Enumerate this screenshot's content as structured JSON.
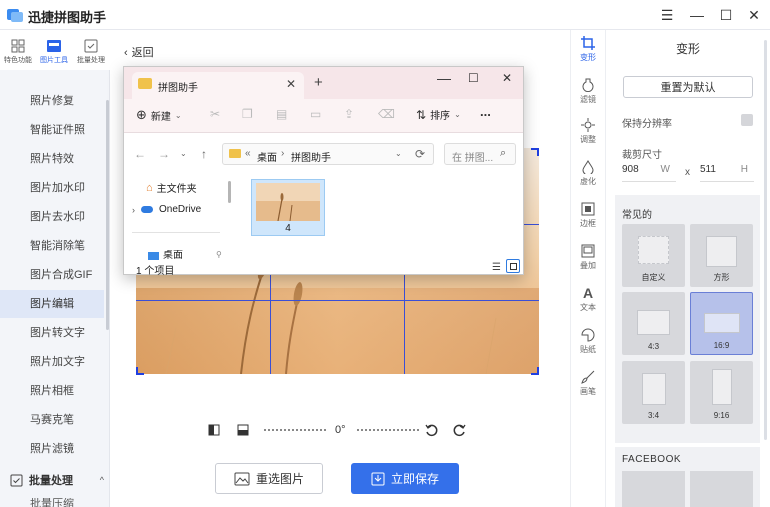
{
  "app": {
    "title": "迅捷拼图助手"
  },
  "topnav": [
    {
      "label": "特色功能"
    },
    {
      "label": "图片工具"
    },
    {
      "label": "批量处理"
    }
  ],
  "sidebar": {
    "items": [
      {
        "label": "照片修复"
      },
      {
        "label": "智能证件照"
      },
      {
        "label": "照片特效"
      },
      {
        "label": "图片加水印"
      },
      {
        "label": "图片去水印"
      },
      {
        "label": "智能消除笔"
      },
      {
        "label": "图片合成GIF"
      },
      {
        "label": "图片编辑"
      },
      {
        "label": "图片转文字"
      },
      {
        "label": "照片加文字"
      },
      {
        "label": "照片相框"
      },
      {
        "label": "马赛克笔"
      },
      {
        "label": "照片滤镜"
      }
    ],
    "active_index": 7,
    "group": {
      "label": "批量处理",
      "caret": "^"
    },
    "partial_label": "批量压缩"
  },
  "main": {
    "back_label": "返回",
    "rotation": "0°",
    "reselect_label": "重选图片",
    "save_label": "立即保存"
  },
  "tooltabs": [
    {
      "label": "变形",
      "icon": "crop-icon"
    },
    {
      "label": "滤镜",
      "icon": "filter-icon"
    },
    {
      "label": "调整",
      "icon": "adjust-icon"
    },
    {
      "label": "虚化",
      "icon": "blur-icon"
    },
    {
      "label": "边框",
      "icon": "frame-icon"
    },
    {
      "label": "叠加",
      "icon": "overlay-icon"
    },
    {
      "label": "文本",
      "icon": "text-icon"
    },
    {
      "label": "贴纸",
      "icon": "sticker-icon"
    },
    {
      "label": "画笔",
      "icon": "brush-icon"
    }
  ],
  "panel": {
    "title": "变形",
    "reset_label": "重置为默认",
    "keep_ratio_label": "保持分辨率",
    "crop_size_label": "裁剪尺寸",
    "width": "908",
    "width_unit": "W",
    "times": "x",
    "height": "511",
    "height_unit": "H",
    "common_label": "常见的",
    "presets": [
      {
        "label": "自定义"
      },
      {
        "label": "方形"
      },
      {
        "label": "4:3"
      },
      {
        "label": "16:9"
      },
      {
        "label": "3:4"
      },
      {
        "label": "9:16"
      }
    ],
    "selected_preset": "16:9",
    "facebook_label": "FACEBOOK"
  },
  "explorer": {
    "tab_title": "拼图助手",
    "new_label": "新建",
    "sort_label": "排序",
    "more_label": "...",
    "breadcrumb": [
      "桌面",
      "拼图助手"
    ],
    "search_placeholder": "在 拼图...",
    "nav": [
      {
        "label": "主文件夹"
      },
      {
        "label": "OneDrive"
      },
      {
        "label": "桌面"
      }
    ],
    "files": [
      {
        "name": "4"
      }
    ],
    "status": "1 个项目"
  },
  "colors": {
    "accent": "#3470ea",
    "crop_grid": "#3a4fd6",
    "sidebar_active": "#dfe7f7",
    "explorer_tab": "#f6e6e9"
  }
}
